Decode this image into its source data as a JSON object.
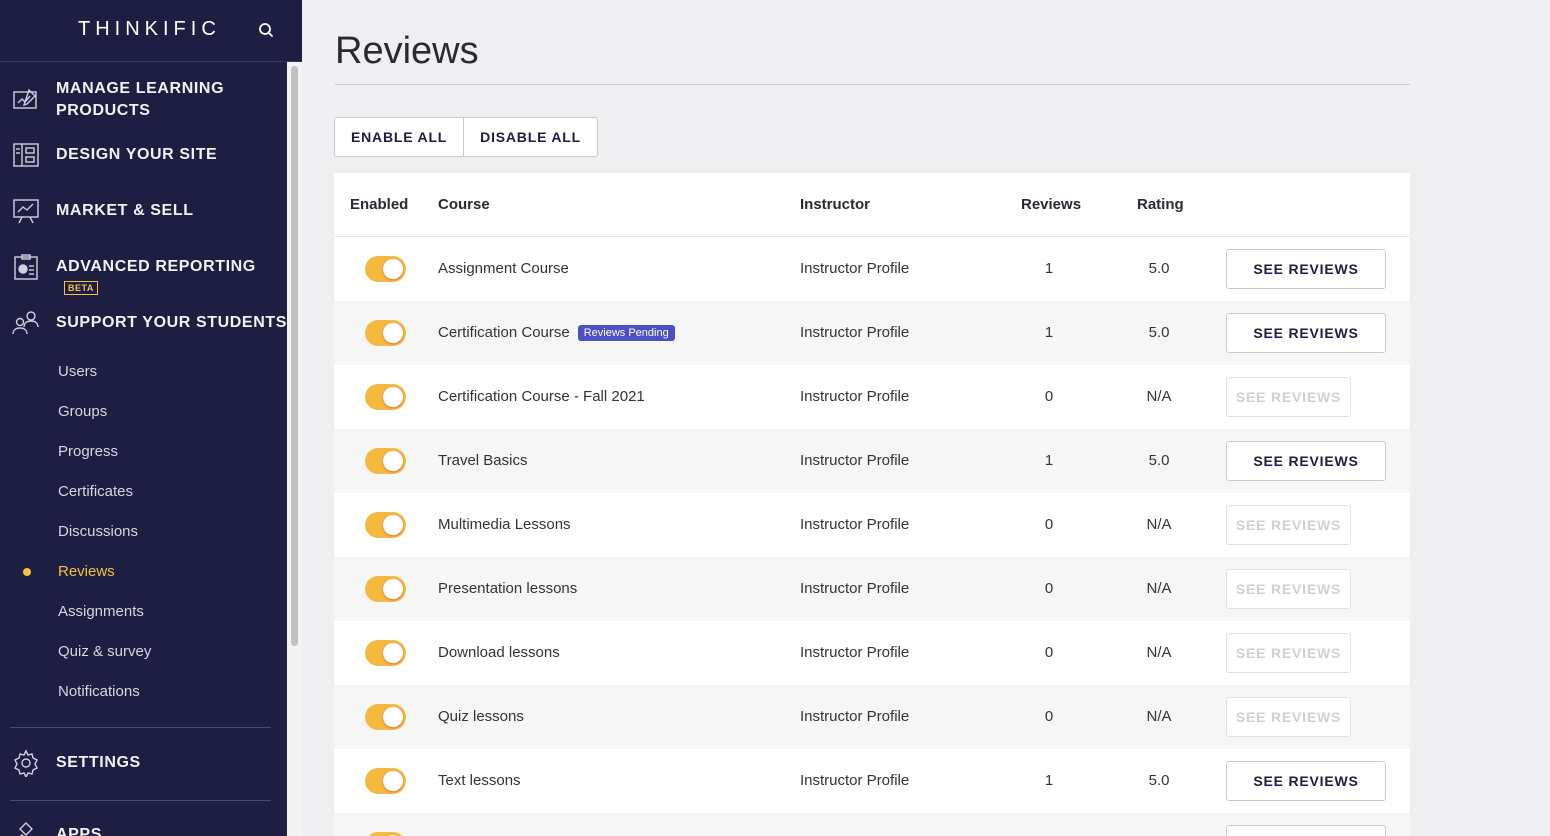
{
  "brand": "THINKIFIC",
  "sidebar": {
    "sections": [
      {
        "label_line1": "MANAGE LEARNING",
        "label_line2": "PRODUCTS",
        "icon": "edit-board-icon"
      },
      {
        "label": "DESIGN YOUR SITE",
        "icon": "layout-icon"
      },
      {
        "label": "MARKET & SELL",
        "icon": "chart-presentation-icon"
      },
      {
        "label": "ADVANCED REPORTING",
        "badge": "BETA",
        "icon": "report-clipboard-icon"
      },
      {
        "label": "SUPPORT YOUR STUDENTS",
        "icon": "users-group-icon"
      }
    ],
    "sub_items": [
      "Users",
      "Groups",
      "Progress",
      "Certificates",
      "Discussions",
      "Reviews",
      "Assignments",
      "Quiz & survey",
      "Notifications"
    ],
    "active_item": "Reviews",
    "settings": "SETTINGS",
    "apps": "APPS"
  },
  "page": {
    "title": "Reviews",
    "enable_all": "ENABLE ALL",
    "disable_all": "DISABLE ALL"
  },
  "table": {
    "headers": {
      "enabled": "Enabled",
      "course": "Course",
      "instructor": "Instructor",
      "reviews": "Reviews",
      "rating": "Rating"
    },
    "rows": [
      {
        "enabled": true,
        "course": "Assignment Course",
        "badge": "",
        "instructor": "Instructor Profile",
        "reviews": "1",
        "rating": "5.0",
        "button": "SEE REVIEWS",
        "button_enabled": true
      },
      {
        "enabled": true,
        "course": "Certification Course",
        "badge": "Reviews Pending",
        "instructor": "Instructor Profile",
        "reviews": "1",
        "rating": "5.0",
        "button": "SEE REVIEWS",
        "button_enabled": true
      },
      {
        "enabled": true,
        "course": "Certification Course - Fall 2021",
        "badge": "",
        "instructor": "Instructor Profile",
        "reviews": "0",
        "rating": "N/A",
        "button": "SEE REVIEWS",
        "button_enabled": false
      },
      {
        "enabled": true,
        "course": "Travel Basics",
        "badge": "",
        "instructor": "Instructor Profile",
        "reviews": "1",
        "rating": "5.0",
        "button": "SEE REVIEWS",
        "button_enabled": true
      },
      {
        "enabled": true,
        "course": "Multimedia Lessons",
        "badge": "",
        "instructor": "Instructor Profile",
        "reviews": "0",
        "rating": "N/A",
        "button": "SEE REVIEWS",
        "button_enabled": false
      },
      {
        "enabled": true,
        "course": "Presentation lessons",
        "badge": "",
        "instructor": "Instructor Profile",
        "reviews": "0",
        "rating": "N/A",
        "button": "SEE REVIEWS",
        "button_enabled": false
      },
      {
        "enabled": true,
        "course": "Download lessons",
        "badge": "",
        "instructor": "Instructor Profile",
        "reviews": "0",
        "rating": "N/A",
        "button": "SEE REVIEWS",
        "button_enabled": false
      },
      {
        "enabled": true,
        "course": "Quiz lessons",
        "badge": "",
        "instructor": "Instructor Profile",
        "reviews": "0",
        "rating": "N/A",
        "button": "SEE REVIEWS",
        "button_enabled": false
      },
      {
        "enabled": true,
        "course": "Text lessons",
        "badge": "",
        "instructor": "Instructor Profile",
        "reviews": "1",
        "rating": "5.0",
        "button": "SEE REVIEWS",
        "button_enabled": true
      }
    ]
  },
  "colors": {
    "sidebar_bg": "#1e1d42",
    "accent": "#f4c242",
    "toggle_on": "#f4b942",
    "badge_bg": "#4b51c5"
  }
}
